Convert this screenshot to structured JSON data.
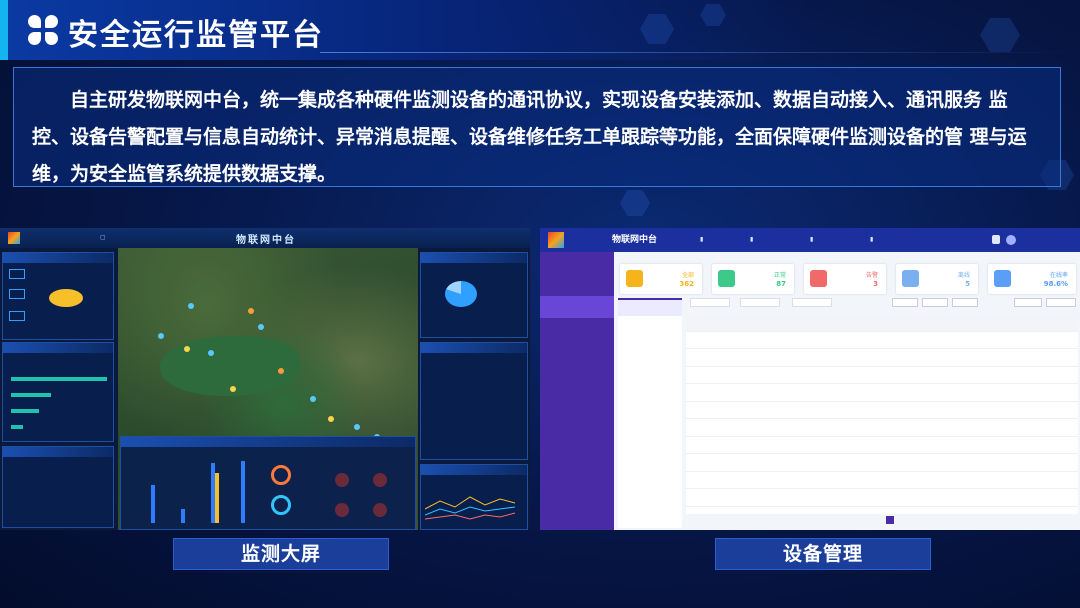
{
  "header": {
    "title": "安全运行监管平台",
    "icon": "four-petal-logo-icon"
  },
  "description": {
    "text": "自主研发物联网中台，统一集成各种硬件监测设备的通讯协议，实现设备安装添加、数据自动接入、通讯服务 监控、设备告警配置与信息自动统计、异常消息提醒、设备维修任务工单跟踪等功能，全面保障硬件监测设备的管 理与运维，为安全监管系统提供数据支撑。"
  },
  "screenshots": {
    "left": {
      "caption": "监测大屏",
      "app_title": "物联网中台"
    },
    "right": {
      "caption": "设备管理",
      "app_title": "物联网中台",
      "stats": [
        {
          "label": "全部",
          "value": "362",
          "color": "#f5b31c"
        },
        {
          "label": "正常",
          "value": "87",
          "color": "#3cc98a"
        },
        {
          "label": "告警",
          "value": "3",
          "color": "#f06a6a"
        },
        {
          "label": "离线",
          "value": "5",
          "color": "#7bb0f0"
        },
        {
          "label": "在线率",
          "value": "98.6%",
          "color": "#5a9ef5"
        }
      ]
    }
  }
}
